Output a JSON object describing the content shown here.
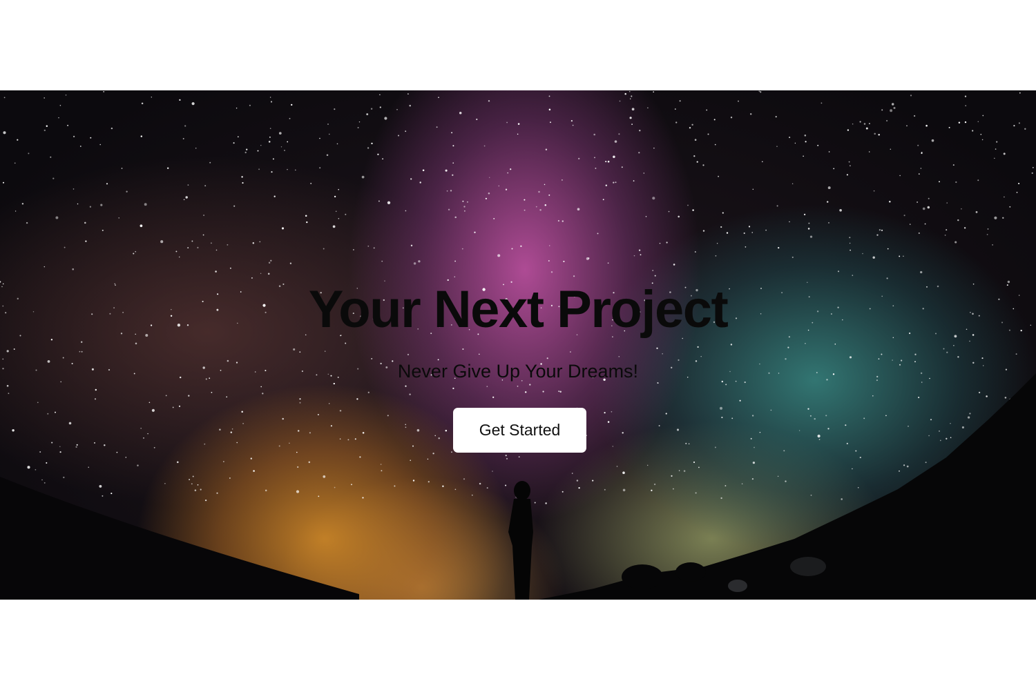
{
  "hero": {
    "title": "Your Next Project",
    "subtitle": "Never Give Up Your Dreams!",
    "cta_label": "Get Started",
    "image_description": "",
    "colors": {
      "title_text": "#0a0a0a",
      "button_background": "#ffffff",
      "button_text": "#111111",
      "page_background": "#ffffff"
    }
  }
}
